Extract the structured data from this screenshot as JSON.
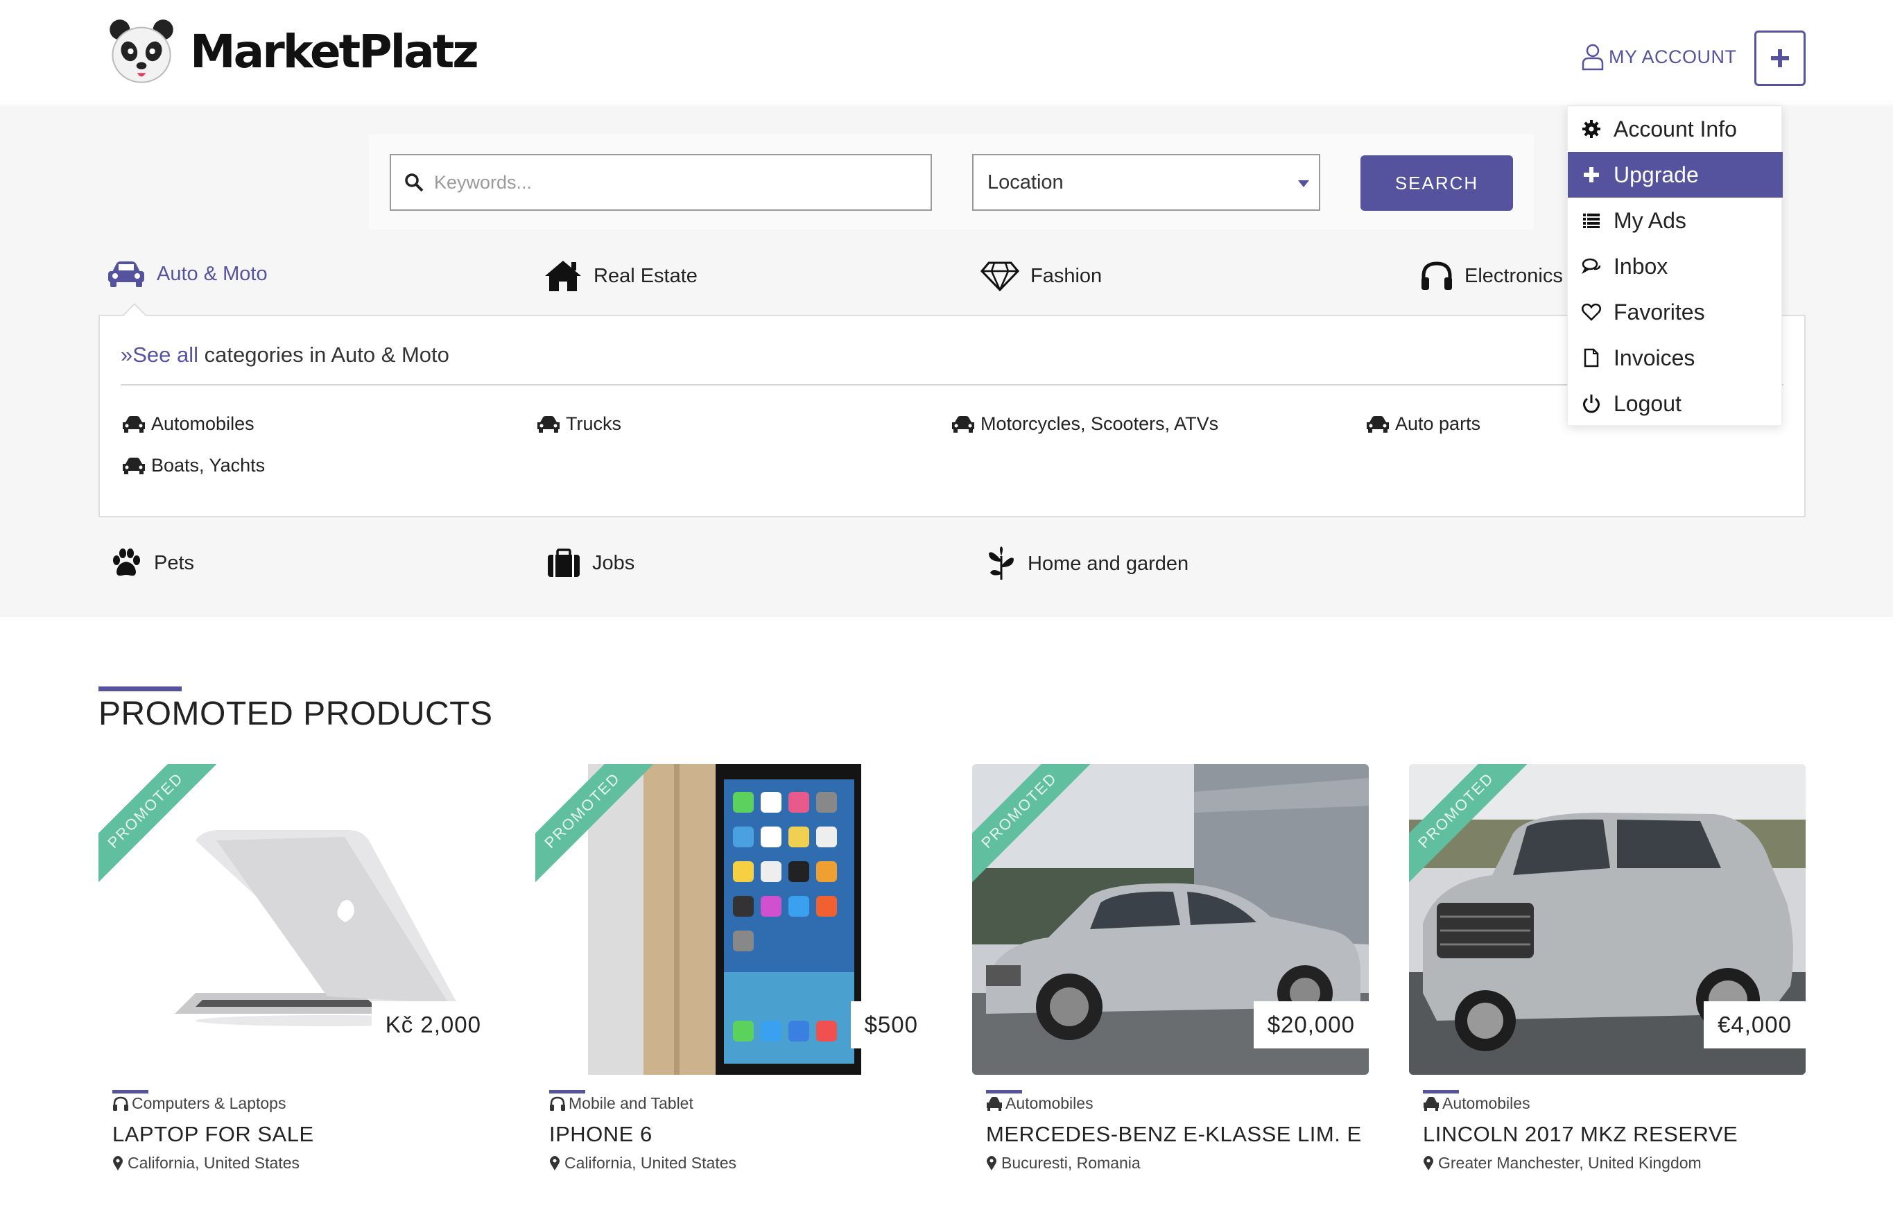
{
  "brand": {
    "name": "MarketPlatz",
    "accent": "#55529e",
    "ribbon_color": "#5fbf9f"
  },
  "header": {
    "account_label": "MY ACCOUNT"
  },
  "search": {
    "keywords_placeholder": "Keywords...",
    "location_value": "Location",
    "button_label": "SEARCH"
  },
  "categories": [
    {
      "label": "Auto & Moto",
      "icon": "car-icon",
      "active": true
    },
    {
      "label": "Real Estate",
      "icon": "house-icon"
    },
    {
      "label": "Fashion",
      "icon": "diamond-icon"
    },
    {
      "label": "Electronics",
      "icon": "headphones-icon"
    },
    {
      "label": "Pets",
      "icon": "paw-icon"
    },
    {
      "label": "Jobs",
      "icon": "briefcase-icon"
    },
    {
      "label": "Home and garden",
      "icon": "plant-icon"
    }
  ],
  "subpanel": {
    "see_all_link": "»See all",
    "see_all_rest": " categories in Auto & Moto",
    "items": [
      "Automobiles",
      "Trucks",
      "Motorcycles, Scooters, ATVs",
      "Auto parts",
      "Boats, Yachts"
    ]
  },
  "account_menu": [
    {
      "label": "Account Info",
      "icon": "gear-icon"
    },
    {
      "label": "Upgrade",
      "icon": "plus-icon",
      "active": true
    },
    {
      "label": "My Ads",
      "icon": "list-icon"
    },
    {
      "label": "Inbox",
      "icon": "chat-icon"
    },
    {
      "label": "Favorites",
      "icon": "heart-icon"
    },
    {
      "label": "Invoices",
      "icon": "document-icon"
    },
    {
      "label": "Logout",
      "icon": "power-icon"
    }
  ],
  "promoted": {
    "title": "PROMOTED PRODUCTS",
    "ribbon_label": "PROMOTED",
    "products": [
      {
        "price": "Kč 2,000",
        "category": "Computers & Laptops",
        "title": "LAPTOP FOR SALE",
        "location": "California, United States"
      },
      {
        "price": "$500",
        "category": "Mobile and Tablet",
        "title": "IPHONE 6",
        "location": "California, United States"
      },
      {
        "price": "$20,000",
        "category": "Automobiles",
        "title": "MERCEDES-BENZ E-KLASSE LIM. E",
        "location": "Bucuresti, Romania"
      },
      {
        "price": "€4,000",
        "category": "Automobiles",
        "title": "LINCOLN 2017 MKZ RESERVE",
        "location": "Greater Manchester, United Kingdom"
      }
    ]
  }
}
